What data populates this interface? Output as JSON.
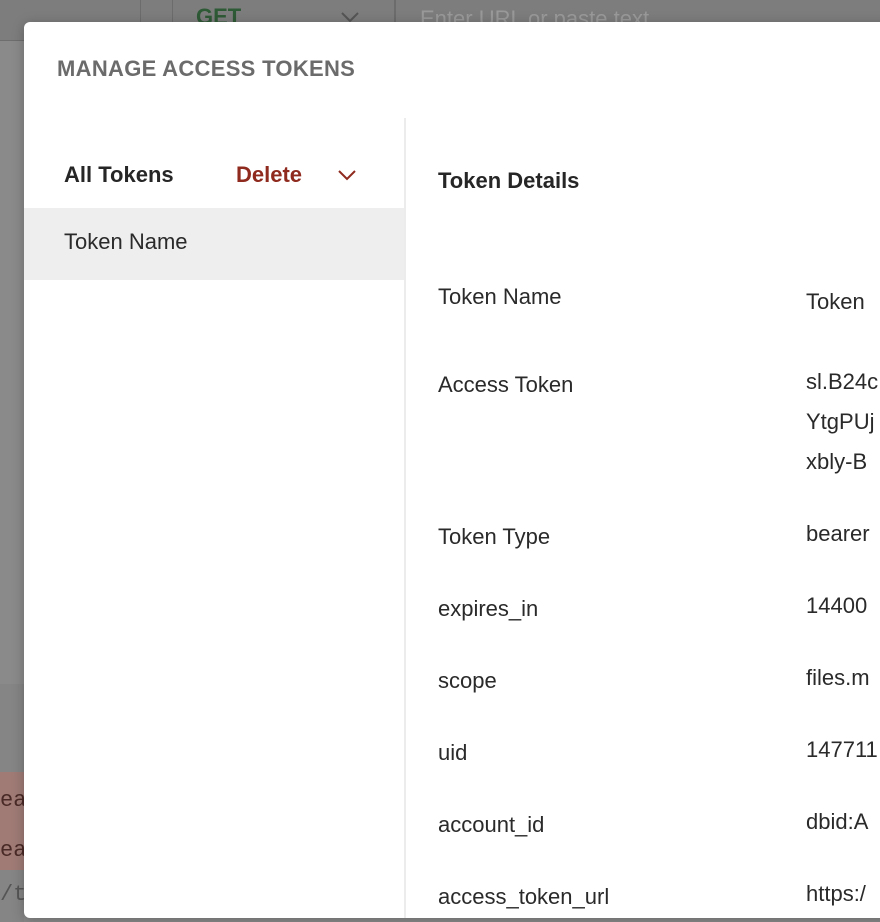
{
  "background": {
    "method": "GET",
    "url_placeholder": "Enter URL or paste text",
    "fragments": [
      "ea",
      "ea",
      "/t"
    ]
  },
  "modal": {
    "title": "MANAGE ACCESS TOKENS",
    "list": {
      "header_label": "All Tokens",
      "delete_label": "Delete",
      "items": [
        {
          "label": "Token Name"
        }
      ]
    },
    "details": {
      "title": "Token Details",
      "rows": [
        {
          "label": "Token Name",
          "value": [
            "Token"
          ]
        },
        {
          "label": "Access Token",
          "value": [
            "sl.B24c",
            "YtgPUj",
            "xbly-B"
          ]
        },
        {
          "label": "Token Type",
          "value": [
            "bearer"
          ]
        },
        {
          "label": "expires_in",
          "value": [
            "14400"
          ]
        },
        {
          "label": "scope",
          "value": [
            "files.m"
          ]
        },
        {
          "label": "uid",
          "value": [
            "147711"
          ]
        },
        {
          "label": "account_id",
          "value": [
            "dbid:A"
          ]
        },
        {
          "label": "access_token_url",
          "value": [
            "https:/"
          ]
        }
      ]
    }
  },
  "colors": {
    "delete": "#8f2a1e",
    "selected_row": "#eeeeee",
    "title_gray": "#6b6b6b"
  }
}
